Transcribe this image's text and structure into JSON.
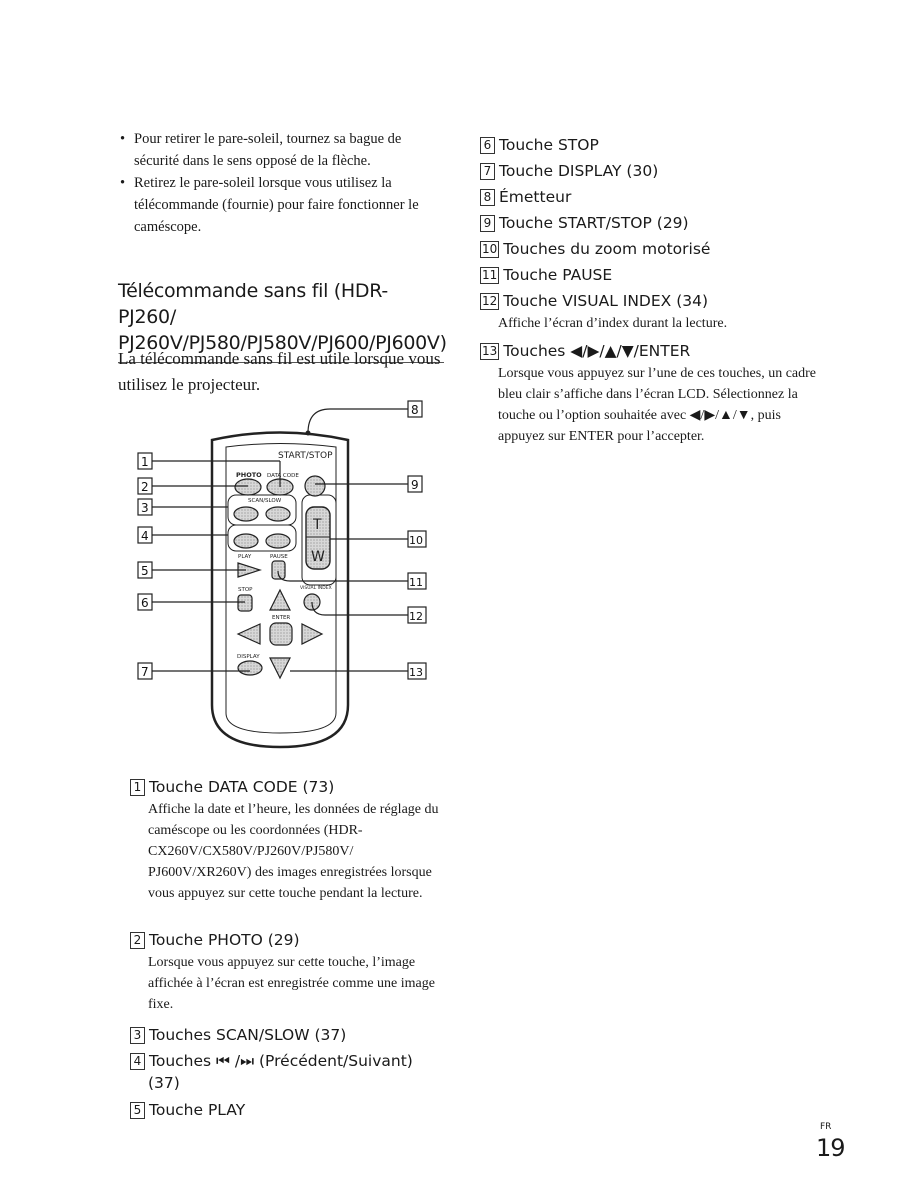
{
  "bullets": [
    "Pour retirer le pare-soleil, tournez sa bague de sécurité dans le sens opposé de la flèche.",
    "Retirez le pare-soleil lorsque vous utilisez la télécommande (fournie) pour faire fonctionner le caméscope."
  ],
  "section": {
    "title_line1": "Télécommande sans fil (HDR-PJ260/",
    "title_line2": "PJ260V/PJ580/PJ580V/PJ600/PJ600V)",
    "intro": "La télécommande sans fil est utile lorsque vous utilisez le projecteur."
  },
  "diagram": {
    "labels": {
      "start_stop": "START/STOP",
      "photo": "PHOTO",
      "data_code": "DATA CODE",
      "scan_slow": "SCAN/SLOW",
      "play": "PLAY",
      "pause": "PAUSE",
      "visual_index": "VISUAL INDEX",
      "stop": "STOP",
      "enter": "ENTER",
      "display": "DISPLAY",
      "zoom_t": "T",
      "zoom_w": "W"
    },
    "callouts": [
      "1",
      "2",
      "3",
      "4",
      "5",
      "6",
      "7",
      "8",
      "9",
      "10",
      "11",
      "12",
      "13"
    ]
  },
  "items": [
    {
      "num": "1",
      "title": "Touche DATA CODE (73)",
      "desc": "Affiche la date et l’heure, les données de réglage du caméscope ou les coordonnées (HDR-CX260V/CX580V/PJ260V/PJ580V/ PJ600V/XR260V) des images enregistrées lorsque vous appuyez sur cette touche pendant la lecture."
    },
    {
      "num": "2",
      "title": "Touche PHOTO (29)",
      "desc": "Lorsque vous appuyez sur cette touche, l’image affichée à l’écran est enregistrée comme une image fixe."
    },
    {
      "num": "3",
      "title": "Touches SCAN/SLOW (37)",
      "desc": ""
    },
    {
      "num": "4",
      "title": "Touches ⏮ /⏭ (Précédent/Suivant)",
      "title_cont": "(37)",
      "desc": ""
    },
    {
      "num": "5",
      "title": "Touche PLAY",
      "desc": ""
    },
    {
      "num": "6",
      "title": "Touche STOP",
      "desc": ""
    },
    {
      "num": "7",
      "title": "Touche DISPLAY (30)",
      "desc": ""
    },
    {
      "num": "8",
      "title": "Émetteur",
      "desc": ""
    },
    {
      "num": "9",
      "title": "Touche START/STOP (29)",
      "desc": ""
    },
    {
      "num": "10",
      "title": "Touches du zoom motorisé",
      "desc": ""
    },
    {
      "num": "11",
      "title": "Touche PAUSE",
      "desc": ""
    },
    {
      "num": "12",
      "title": "Touche VISUAL INDEX (34)",
      "desc": "Affiche l’écran d’index durant la lecture."
    },
    {
      "num": "13",
      "title": "Touches ◀/▶/▲/▼/ENTER",
      "desc": "Lorsque vous appuyez sur l’une de ces touches, un cadre bleu clair s’affiche dans l’écran LCD. Sélectionnez la touche ou l’option souhaitée avec ◀/▶/▲/▼, puis appuyez sur ENTER pour l’accepter."
    }
  ],
  "footer": {
    "lang": "FR",
    "page": "19"
  }
}
